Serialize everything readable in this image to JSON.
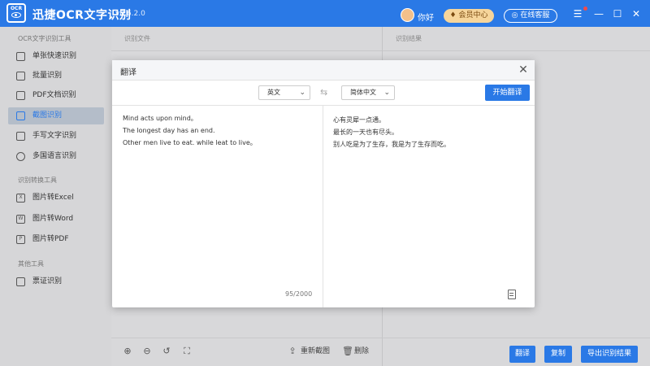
{
  "app": {
    "logo_text": "OCR",
    "title": "迅捷OCR文字识别",
    "version": "v8.6.2.0",
    "greeting": "你好",
    "vip_label": "会员中心",
    "service_label": "在线客服",
    "accent": "#2a79e6"
  },
  "window": {
    "menu_icon": "☰",
    "minimize_icon": "—",
    "maximize_icon": "☐",
    "close_icon": "✕"
  },
  "sidebar": {
    "sections": [
      {
        "title": "OCR文字识别工具",
        "items": [
          {
            "label": "单张快速识别"
          },
          {
            "label": "批量识别"
          },
          {
            "label": "PDF文档识别"
          },
          {
            "label": "截图识别"
          },
          {
            "label": "手写文字识别"
          },
          {
            "label": "多国语言识别"
          }
        ]
      },
      {
        "title": "识别转换工具",
        "items": [
          {
            "label": "图片转Excel"
          },
          {
            "label": "图片转Word"
          },
          {
            "label": "图片转PDF"
          }
        ]
      },
      {
        "title": "其他工具",
        "items": [
          {
            "label": "票证识别"
          }
        ]
      }
    ],
    "active_item": "截图识别"
  },
  "main": {
    "left_header": "识别文件",
    "right_header": "识别结果",
    "rescreenshot_label": "重新截图",
    "delete_label": "删除",
    "translate_label": "翻译",
    "copy_label": "复制",
    "export_label": "导出识别结果"
  },
  "dialog": {
    "title": "翻译",
    "source_lang": "英文",
    "target_lang": "简体中文",
    "start_label": "开始翻译",
    "source_lines": [
      "Mind acts upon mind。",
      "The longest day has an end.",
      "Other men live to eat.   while leat to live。"
    ],
    "target_lines": [
      "心有灵犀一点通。",
      "最长的一天也有尽头。",
      "别人吃是为了生存，我是为了生存而吃。"
    ],
    "char_count": "95/2000"
  }
}
